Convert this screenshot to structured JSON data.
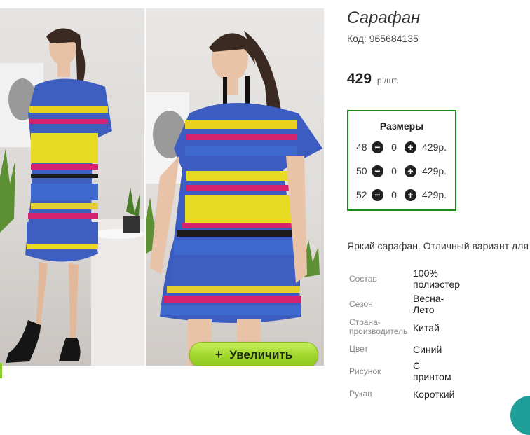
{
  "product": {
    "title": "Сарафан",
    "code_label": "Код:",
    "code_value": "965684135",
    "price_value": "429",
    "price_unit": "р./шт.",
    "description": "Яркий сарафан. Отличный вариант для"
  },
  "gallery": {
    "zoom_plus": "+",
    "zoom_label": "Увеличить"
  },
  "sizes": {
    "title": "Размеры",
    "minus_symbol": "−",
    "plus_symbol": "+",
    "rows": [
      {
        "size": "48",
        "qty": "0",
        "price": "429р."
      },
      {
        "size": "50",
        "qty": "0",
        "price": "429р."
      },
      {
        "size": "52",
        "qty": "0",
        "price": "429р."
      }
    ]
  },
  "specs": [
    {
      "label": "Состав",
      "value": "100% полиэстер"
    },
    {
      "label": "Сезон",
      "value": "Весна-Лето"
    },
    {
      "label": "Страна-производитель",
      "value": "Китай"
    },
    {
      "label": "Цвет",
      "value": "Синий"
    },
    {
      "label": "Рисунок",
      "value": "С принтом"
    },
    {
      "label": "Рукав",
      "value": "Короткий"
    }
  ],
  "colors": {
    "accent_green": "#1d8a1d",
    "button_green": "#9fd72c",
    "fab_teal": "#1f9e9a"
  }
}
